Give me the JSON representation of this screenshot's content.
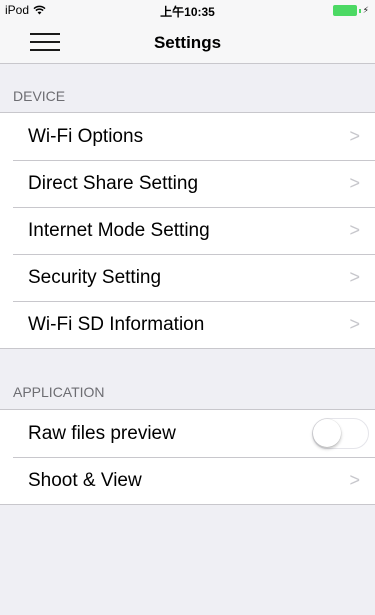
{
  "status_bar": {
    "device": "iPod",
    "time": "上午10:35",
    "wifi_icon": "wifi-icon",
    "battery_icon": "battery-icon",
    "charging_icon": "charging-bolt-icon"
  },
  "nav": {
    "title": "Settings",
    "menu_icon": "hamburger-menu-icon"
  },
  "sections": {
    "device": {
      "header": "DEVICE",
      "items": [
        {
          "label": "Wi-Fi Options"
        },
        {
          "label": "Direct Share Setting"
        },
        {
          "label": "Internet Mode Setting"
        },
        {
          "label": "Security Setting"
        },
        {
          "label": "Wi-Fi SD Information"
        }
      ]
    },
    "application": {
      "header": "APPLICATION",
      "items": [
        {
          "label": "Raw files preview",
          "toggle": false
        },
        {
          "label": "Shoot & View"
        }
      ]
    }
  },
  "chevron_glyph": ">",
  "colors": {
    "background": "#efeff4",
    "separator": "#c8c7cc",
    "chevron": "#c7c7cc",
    "battery": "#4cd964",
    "section_header": "#6d6d72"
  }
}
